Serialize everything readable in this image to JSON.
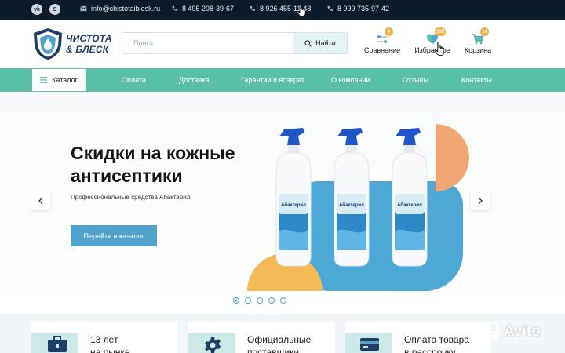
{
  "topbar": {
    "social": [
      {
        "icon": "vk-icon",
        "label": "vk"
      },
      {
        "icon": "skype-icon",
        "label": "S"
      }
    ],
    "email": "info@chistotaiblesk.ru",
    "phones": [
      "8 495 208-39-67",
      "8 926 455-11-48",
      "8 999 735-97-42"
    ]
  },
  "header": {
    "logo_line1": "ЧИСТОТА",
    "logo_line2": "& БЛЕСК",
    "search_placeholder": "Поиск",
    "search_button": "Найти",
    "icons": [
      {
        "icon": "compare-icon",
        "label": "Сравнение",
        "badge": "4"
      },
      {
        "icon": "heart-icon",
        "label": "Избранное",
        "badge": "105"
      },
      {
        "icon": "cart-icon",
        "label": "Корзина",
        "badge": "14"
      }
    ]
  },
  "nav": {
    "catalog": "Каталог",
    "items": [
      "Оплата",
      "Доставка",
      "Гарантии и возврат",
      "О компании",
      "Отзывы",
      "Контакты"
    ]
  },
  "hero": {
    "title": "Скидки на кожные антисептики",
    "subtitle": "Профессиональные средства Абактерил",
    "cta": "Перейти в каталог",
    "bottle_label": "Абактерил",
    "slides_total": 5,
    "active_slide": 1
  },
  "features": [
    {
      "icon": "briefcase-icon",
      "line1": "13 лет",
      "line2": "на рынке"
    },
    {
      "icon": "gear-icon",
      "line1": "Официальные",
      "line2": "поставщики"
    },
    {
      "icon": "card-icon",
      "line1": "Оплата товара",
      "line2": "в рассрочку"
    }
  ],
  "watermark": "Avito",
  "colors": {
    "topbar": "#0c1b2a",
    "nav": "#5bc0a8",
    "accent_blue": "#4fa3cc",
    "badge": "#f0b04a",
    "logo": "#1d3e66"
  }
}
